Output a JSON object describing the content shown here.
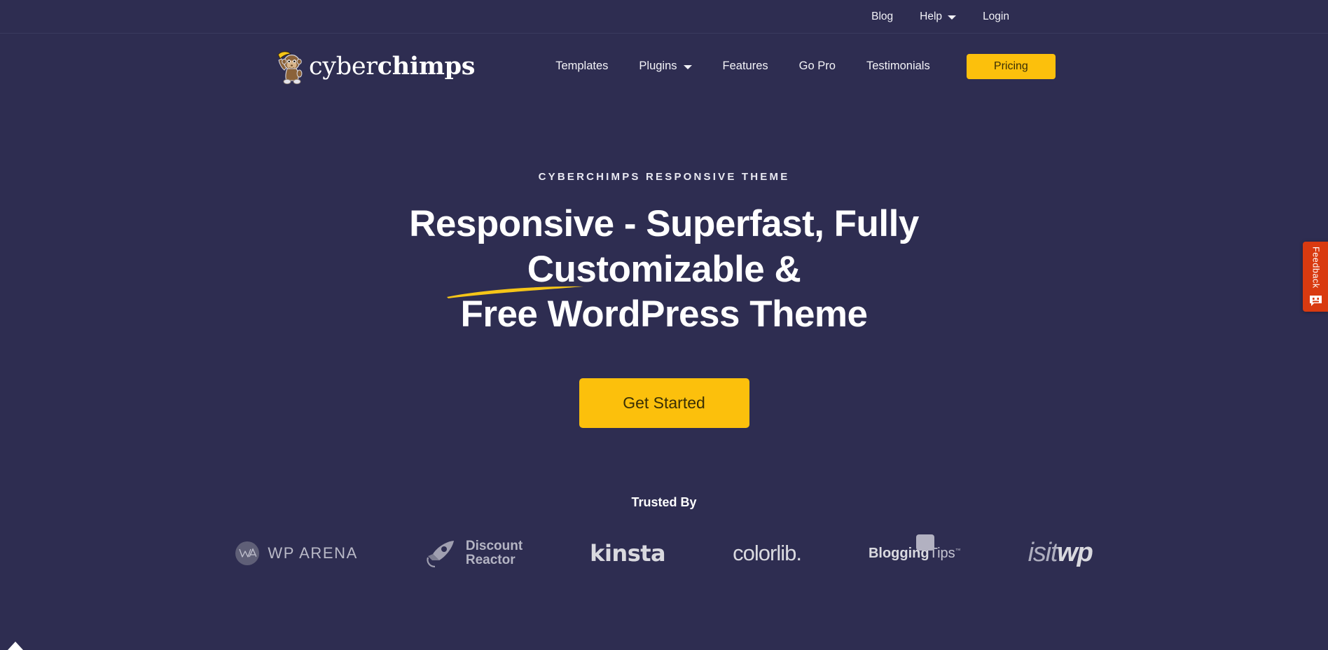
{
  "topbar": {
    "links": [
      {
        "label": "Blog",
        "icon": null
      },
      {
        "label": "Help",
        "icon": "chevron-down-icon"
      },
      {
        "label": "Login",
        "icon": null
      }
    ]
  },
  "header": {
    "logo": {
      "text_light": "cyber",
      "text_bold": "chimps",
      "icon": "chimp-with-banana-logo"
    },
    "nav": [
      {
        "label": "Templates",
        "icon": null
      },
      {
        "label": "Plugins",
        "icon": "chevron-down-icon"
      },
      {
        "label": "Features",
        "icon": null
      },
      {
        "label": "Go Pro",
        "icon": null
      },
      {
        "label": "Testimonials",
        "icon": null
      }
    ],
    "pricing_button": "Pricing"
  },
  "hero": {
    "eyebrow": "CYBERCHIMPS RESPONSIVE THEME",
    "headline_line1": "Responsive - Superfast, Fully Customizable &",
    "headline_line2": "Free WordPress Theme",
    "cta_label": "Get Started"
  },
  "trusted": {
    "title": "Trusted By",
    "brands": [
      {
        "name": "WP ARENA",
        "monogram": "WA"
      },
      {
        "name_line1": "Discount",
        "name_line2": "Reactor",
        "icon": "rocket-icon"
      },
      {
        "name": "kinsta"
      },
      {
        "name": "colorlib."
      },
      {
        "name_bold": "Blogging",
        "name_light": "Tips",
        "trademark": "™"
      },
      {
        "name_light": "isit",
        "name_bold": "wp"
      }
    ]
  },
  "feedback": {
    "label": "Feedback",
    "icon": "smiley-face-icon"
  },
  "colors": {
    "background": "#2e2d51",
    "accent_yellow": "#fcc00c",
    "feedback_orange": "#d93a10",
    "text_primary": "#ffffff",
    "button_text": "#3a2f05"
  }
}
